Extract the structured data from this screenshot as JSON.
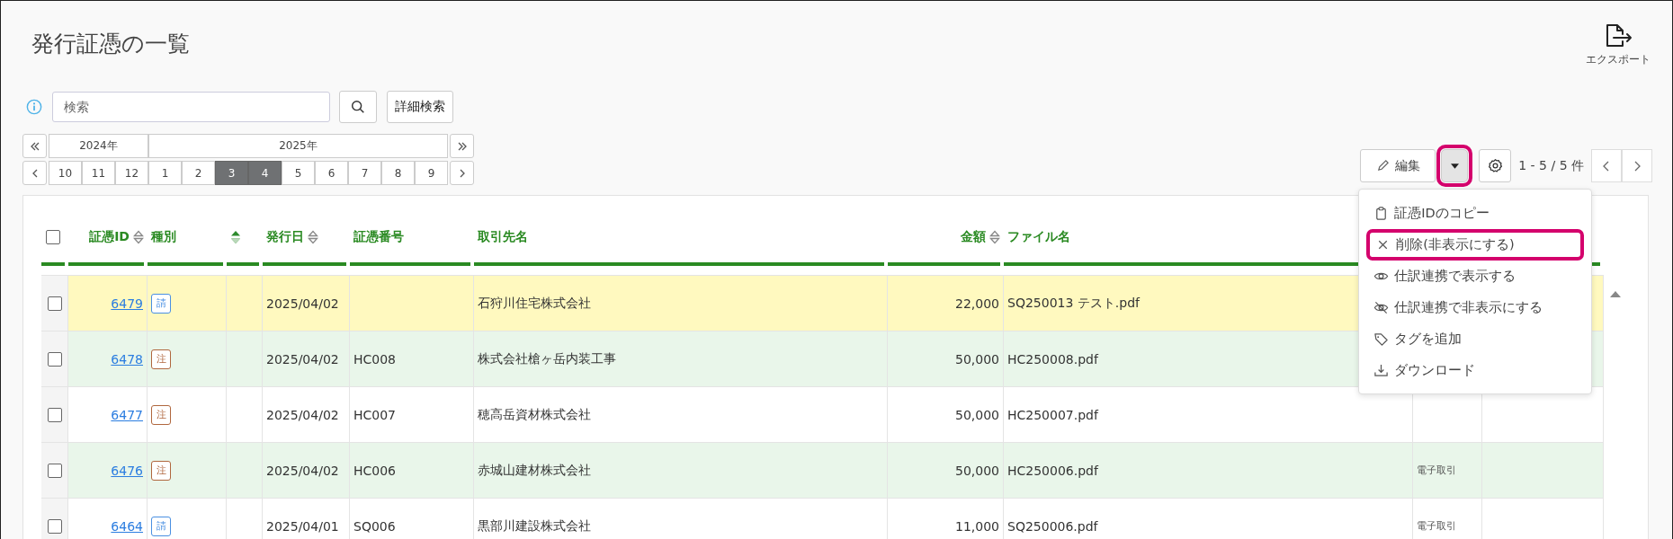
{
  "page": {
    "title": "発行証憑の一覧"
  },
  "export": {
    "label": "エクスポート"
  },
  "search": {
    "placeholder": "検索",
    "advanced_label": "詳細検索"
  },
  "period": {
    "years": [
      {
        "label": "2024年",
        "months": [
          {
            "label": "10",
            "selected": false
          },
          {
            "label": "11",
            "selected": false
          },
          {
            "label": "12",
            "selected": false
          }
        ]
      },
      {
        "label": "2025年",
        "months": [
          {
            "label": "1",
            "selected": false
          },
          {
            "label": "2",
            "selected": false
          },
          {
            "label": "3",
            "selected": true
          },
          {
            "label": "4",
            "selected": true
          },
          {
            "label": "5",
            "selected": false
          },
          {
            "label": "6",
            "selected": false
          },
          {
            "label": "7",
            "selected": false
          },
          {
            "label": "8",
            "selected": false
          },
          {
            "label": "9",
            "selected": false
          }
        ]
      }
    ]
  },
  "toolbar": {
    "edit_label": "編集",
    "dropdown_highlighted": true,
    "count": "1 - 5 / 5 件"
  },
  "menu": [
    {
      "kind": "clipboard",
      "label": "証憑IDのコピー",
      "highlighted": false
    },
    {
      "kind": "close",
      "label": "削除(非表示にする)",
      "highlighted": true
    },
    {
      "kind": "eye",
      "label": "仕訳連携で表示する",
      "highlighted": false
    },
    {
      "kind": "eye-off",
      "label": "仕訳連携で非表示にする",
      "highlighted": false
    },
    {
      "kind": "tag",
      "label": "タグを追加",
      "highlighted": false
    },
    {
      "kind": "download",
      "label": "ダウンロード",
      "highlighted": false
    }
  ],
  "table": {
    "select_all_checked": false,
    "columns": [
      {
        "label": "証憑ID",
        "sorted": false
      },
      {
        "label": "種別"
      },
      {
        "sorted": true
      },
      {
        "label": "発行日",
        "sorted": false
      },
      {
        "label": "証憑番号"
      },
      {
        "label": "取引先名"
      },
      {
        "label": "金額",
        "sorted": false
      },
      {
        "label": "ファイル名"
      }
    ],
    "rows": [
      {
        "checked": false,
        "highlighted": true,
        "id": "6479",
        "tag": {
          "text": "請",
          "color": "#4a90e2"
        },
        "date": "2025/04/02",
        "partner": "石狩川住宅株式会社",
        "amount": "22,000",
        "file": "SQ250013 テスト.pdf"
      },
      {
        "checked": false,
        "highlighted": false,
        "id": "6478",
        "tag": {
          "text": "注",
          "color": "#b0673e"
        },
        "date": "2025/04/02",
        "number": "HC008",
        "partner": "株式会社槍ヶ岳内装工事",
        "amount": "50,000",
        "file": "HC250008.pdf"
      },
      {
        "checked": false,
        "highlighted": false,
        "id": "6477",
        "tag": {
          "text": "注",
          "color": "#b0673e"
        },
        "date": "2025/04/02",
        "number": "HC007",
        "partner": "穂高岳資材株式会社",
        "amount": "50,000",
        "file": "HC250007.pdf"
      },
      {
        "checked": false,
        "highlighted": false,
        "id": "6476",
        "tag": {
          "text": "注",
          "color": "#b0673e"
        },
        "date": "2025/04/02",
        "number": "HC006",
        "partner": "赤城山建材株式会社",
        "amount": "50,000",
        "file": "HC250006.pdf",
        "column_9": "電子取引"
      },
      {
        "checked": false,
        "highlighted": false,
        "id": "6464",
        "tag": {
          "text": "請",
          "color": "#4a90e2"
        },
        "date": "2025/04/01",
        "number": "SQ006",
        "partner": "黒部川建設株式会社",
        "amount": "11,000",
        "file": "SQ250006.pdf",
        "column_9": "電子取引"
      }
    ]
  }
}
